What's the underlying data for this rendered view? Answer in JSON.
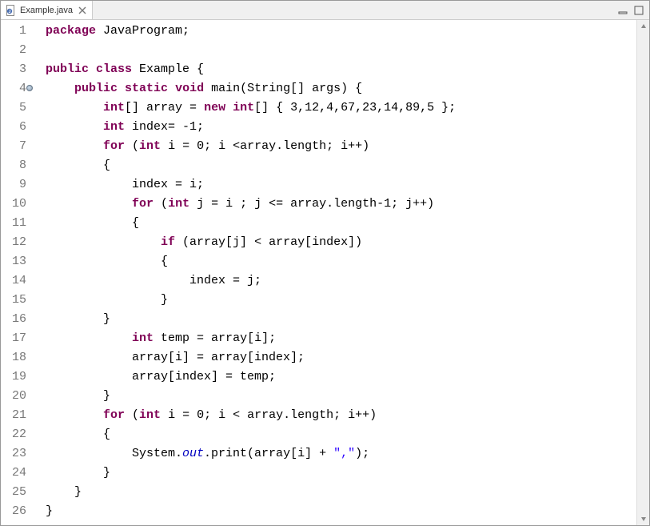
{
  "editor": {
    "tab": {
      "filename": "Example.java",
      "icon": "java-file-icon"
    },
    "lines": [
      {
        "n": 1,
        "marker": false,
        "tokens": [
          [
            "kw",
            "package"
          ],
          [
            "",
            " JavaProgram;"
          ]
        ]
      },
      {
        "n": 2,
        "marker": false,
        "tokens": []
      },
      {
        "n": 3,
        "marker": false,
        "tokens": [
          [
            "kw",
            "public"
          ],
          [
            "",
            " "
          ],
          [
            "kw",
            "class"
          ],
          [
            "",
            " Example {"
          ]
        ]
      },
      {
        "n": 4,
        "marker": true,
        "tokens": [
          [
            "",
            "    "
          ],
          [
            "kw",
            "public"
          ],
          [
            "",
            " "
          ],
          [
            "kw",
            "static"
          ],
          [
            "",
            " "
          ],
          [
            "kw",
            "void"
          ],
          [
            "",
            " main(String[] args) {"
          ]
        ]
      },
      {
        "n": 5,
        "marker": false,
        "tokens": [
          [
            "",
            "        "
          ],
          [
            "kw",
            "int"
          ],
          [
            "",
            "[] array = "
          ],
          [
            "kw",
            "new"
          ],
          [
            "",
            " "
          ],
          [
            "kw",
            "int"
          ],
          [
            "",
            "[] { 3,12,4,67,23,14,89,5 };"
          ]
        ]
      },
      {
        "n": 6,
        "marker": false,
        "tokens": [
          [
            "",
            "        "
          ],
          [
            "kw",
            "int"
          ],
          [
            "",
            " index= -1;"
          ]
        ]
      },
      {
        "n": 7,
        "marker": false,
        "tokens": [
          [
            "",
            "        "
          ],
          [
            "kw",
            "for"
          ],
          [
            "",
            " ("
          ],
          [
            "kw",
            "int"
          ],
          [
            "",
            " i = 0; i <array.length; i++)"
          ]
        ]
      },
      {
        "n": 8,
        "marker": false,
        "tokens": [
          [
            "",
            "        {"
          ]
        ]
      },
      {
        "n": 9,
        "marker": false,
        "tokens": [
          [
            "",
            "            index = i;"
          ]
        ]
      },
      {
        "n": 10,
        "marker": false,
        "tokens": [
          [
            "",
            "            "
          ],
          [
            "kw",
            "for"
          ],
          [
            "",
            " ("
          ],
          [
            "kw",
            "int"
          ],
          [
            "",
            " j = i ; j <= array.length-1; j++)"
          ]
        ]
      },
      {
        "n": 11,
        "marker": false,
        "tokens": [
          [
            "",
            "            {"
          ]
        ]
      },
      {
        "n": 12,
        "marker": false,
        "tokens": [
          [
            "",
            "                "
          ],
          [
            "kw",
            "if"
          ],
          [
            "",
            " (array[j] < array[index])"
          ]
        ]
      },
      {
        "n": 13,
        "marker": false,
        "tokens": [
          [
            "",
            "                {"
          ]
        ]
      },
      {
        "n": 14,
        "marker": false,
        "tokens": [
          [
            "",
            "                    index = j;"
          ]
        ]
      },
      {
        "n": 15,
        "marker": false,
        "tokens": [
          [
            "",
            "                }"
          ]
        ]
      },
      {
        "n": 16,
        "marker": false,
        "tokens": [
          [
            "",
            "        }"
          ]
        ]
      },
      {
        "n": 17,
        "marker": false,
        "tokens": [
          [
            "",
            "            "
          ],
          [
            "kw",
            "int"
          ],
          [
            "",
            " temp = array[i];"
          ]
        ]
      },
      {
        "n": 18,
        "marker": false,
        "tokens": [
          [
            "",
            "            array[i] = array[index];"
          ]
        ]
      },
      {
        "n": 19,
        "marker": false,
        "tokens": [
          [
            "",
            "            array[index] = temp;"
          ]
        ]
      },
      {
        "n": 20,
        "marker": false,
        "tokens": [
          [
            "",
            "        }"
          ]
        ]
      },
      {
        "n": 21,
        "marker": false,
        "tokens": [
          [
            "",
            "        "
          ],
          [
            "kw",
            "for"
          ],
          [
            "",
            " ("
          ],
          [
            "kw",
            "int"
          ],
          [
            "",
            " i = 0; i < array.length; i++)"
          ]
        ]
      },
      {
        "n": 22,
        "marker": false,
        "tokens": [
          [
            "",
            "        {"
          ]
        ]
      },
      {
        "n": 23,
        "marker": false,
        "tokens": [
          [
            "",
            "            System."
          ],
          [
            "sf",
            "out"
          ],
          [
            "",
            ".print(array[i] + "
          ],
          [
            "str",
            "\",\""
          ],
          [
            "",
            ");"
          ]
        ]
      },
      {
        "n": 24,
        "marker": false,
        "tokens": [
          [
            "",
            "        }"
          ]
        ]
      },
      {
        "n": 25,
        "marker": false,
        "tokens": [
          [
            "",
            "    }"
          ]
        ]
      },
      {
        "n": 26,
        "marker": false,
        "tokens": [
          [
            "",
            "}"
          ]
        ]
      }
    ]
  }
}
